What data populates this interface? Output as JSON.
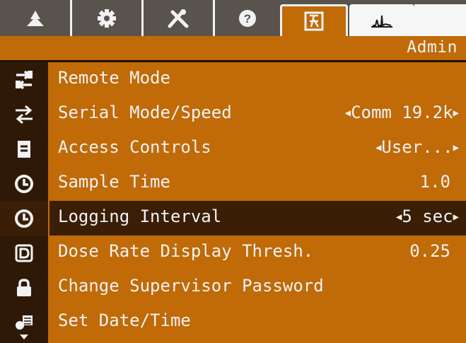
{
  "tabs": [
    {
      "icon": "tree-icon",
      "label": "▲"
    },
    {
      "icon": "gear-icon",
      "label": ""
    },
    {
      "icon": "tools-icon",
      "label": ""
    },
    {
      "icon": "help-icon",
      "label": ""
    },
    {
      "icon": "admin-icon",
      "label": ""
    },
    {
      "icon": "spectrum-icon",
      "label": ""
    }
  ],
  "header": {
    "user": "Admin"
  },
  "menu": [
    {
      "icon": "remote-mode-icon",
      "label": "Remote Mode",
      "value": ""
    },
    {
      "icon": "serial-arrows-icon",
      "label": "Serial Mode/Speed",
      "value": "Comm 19.2k"
    },
    {
      "icon": "document-icon",
      "label": "Access Controls",
      "value": "User..."
    },
    {
      "icon": "clock-icon",
      "label": "Sample Time",
      "value": "1.0"
    },
    {
      "icon": "clock-icon",
      "label": "Logging Interval",
      "value": "5 sec",
      "selected": true
    },
    {
      "icon": "dose-display-icon",
      "label": "Dose Rate Display Thresh.",
      "value": "0.25"
    },
    {
      "icon": "lock-icon",
      "label": "Change Supervisor Password",
      "value": ""
    },
    {
      "icon": "datetime-icon",
      "label": "Set Date/Time",
      "value": ""
    }
  ],
  "colors": {
    "accent": "#c06a08",
    "selected": "#3a1e06",
    "sidebar": "#2e1906",
    "text": "#f2f2f2",
    "tabbar": "#58534d"
  }
}
